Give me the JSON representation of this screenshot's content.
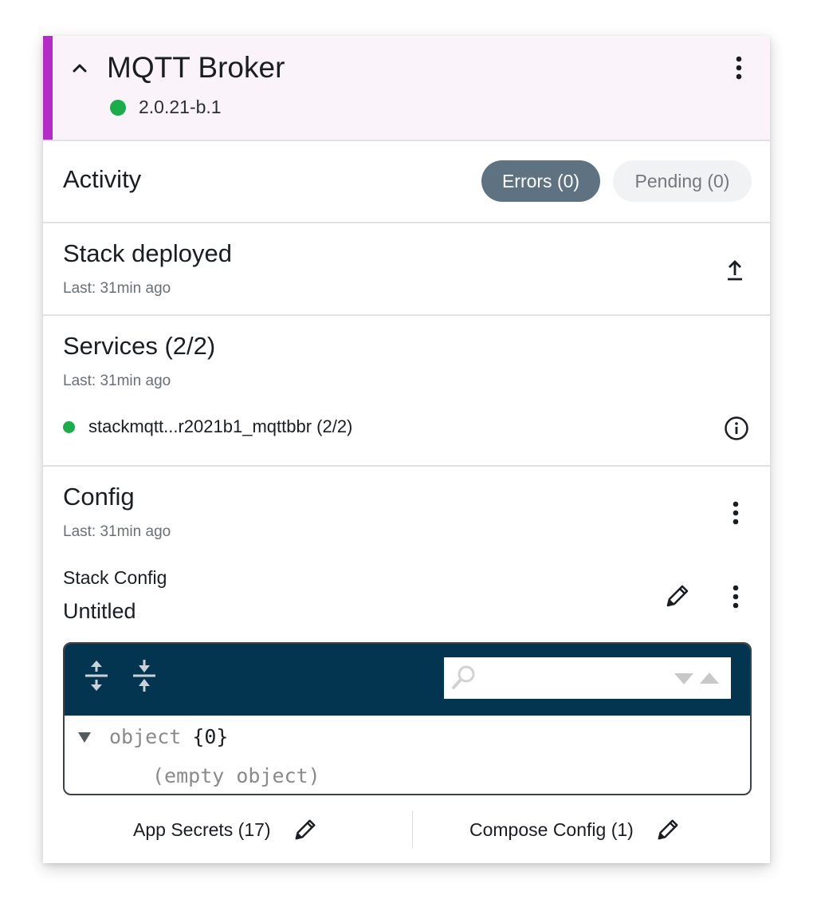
{
  "header": {
    "title": "MQTT Broker",
    "version": "2.0.21-b.1",
    "accent_color": "#b52bc8",
    "status_color": "#1aad4b"
  },
  "activity": {
    "title": "Activity",
    "errors_label": "Errors (0)",
    "pending_label": "Pending (0)"
  },
  "stack_deployed": {
    "title": "Stack deployed",
    "last": "Last: 31min ago",
    "icon": "upload-icon"
  },
  "services": {
    "title": "Services (2/2)",
    "last": "Last: 31min ago",
    "items": [
      {
        "name": "stackmqtt...r2021b1_mqttbbr (2/2)",
        "status": "running",
        "icon": "info-icon"
      }
    ]
  },
  "config": {
    "title": "Config",
    "last": "Last: 31min ago",
    "stack_config_label": "Stack Config",
    "stack_config_name": "Untitled",
    "editor": {
      "search_placeholder": "",
      "tree_key": "object",
      "tree_value": "{0}",
      "empty_text": "(empty object)",
      "toolbar_color": "#033550"
    },
    "footer": {
      "app_secrets_label": "App Secrets (17)",
      "compose_config_label": "Compose Config (1)"
    }
  }
}
